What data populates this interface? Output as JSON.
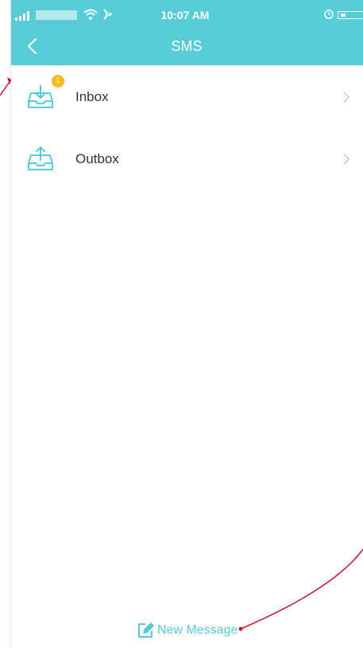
{
  "colors": {
    "accent": "#58ccd6",
    "badge": "#f5b91a",
    "annotation": "#c8102e"
  },
  "status_bar": {
    "time": "10:07 AM"
  },
  "header": {
    "title": "SMS",
    "back_icon": "chevron-left-icon"
  },
  "list": {
    "items": [
      {
        "label": "Inbox",
        "icon": "inbox-download-icon",
        "badge": "1"
      },
      {
        "label": "Outbox",
        "icon": "outbox-upload-icon"
      }
    ]
  },
  "footer": {
    "new_message_label": "New Message",
    "icon": "compose-icon"
  }
}
